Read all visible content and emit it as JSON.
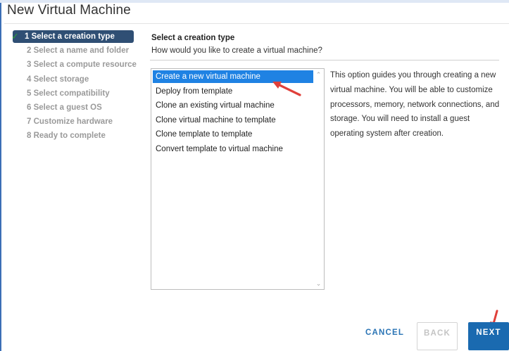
{
  "window": {
    "title": "New Virtual Machine"
  },
  "steps": [
    {
      "label": "1 Select a creation type",
      "active": true,
      "done": true
    },
    {
      "label": "2 Select a name and folder",
      "active": false
    },
    {
      "label": "3 Select a compute resource",
      "active": false
    },
    {
      "label": "4 Select storage",
      "active": false
    },
    {
      "label": "5 Select compatibility",
      "active": false
    },
    {
      "label": "6 Select a guest OS",
      "active": false
    },
    {
      "label": "7 Customize hardware",
      "active": false
    },
    {
      "label": "8 Ready to complete",
      "active": false
    }
  ],
  "content": {
    "title": "Select a creation type",
    "subtitle": "How would you like to create a virtual machine?",
    "options": [
      {
        "label": "Create a new virtual machine",
        "selected": true
      },
      {
        "label": "Deploy from template",
        "selected": false
      },
      {
        "label": "Clone an existing virtual machine",
        "selected": false
      },
      {
        "label": "Clone virtual machine to template",
        "selected": false
      },
      {
        "label": "Clone template to template",
        "selected": false
      },
      {
        "label": "Convert template to virtual machine",
        "selected": false
      }
    ],
    "description": "This option guides you through creating a new virtual machine. You will be able to customize processors, memory, network connections, and storage. You will need to install a guest operating system after creation."
  },
  "icons": {
    "check": "checkmark-icon",
    "scroll_up": "chevron-up-icon",
    "scroll_down": "chevron-down-icon",
    "annotation": "red-arrow-icon"
  },
  "colors": {
    "active_step_bg": "#2f4f74",
    "selection_bg": "#1f82e3",
    "primary_button": "#1a6ab0",
    "annotation_arrow": "#e0403a",
    "check": "#2e9b3c"
  },
  "footer": {
    "cancel_label": "CANCEL",
    "back_label": "BACK",
    "next_label": "NEXT"
  }
}
